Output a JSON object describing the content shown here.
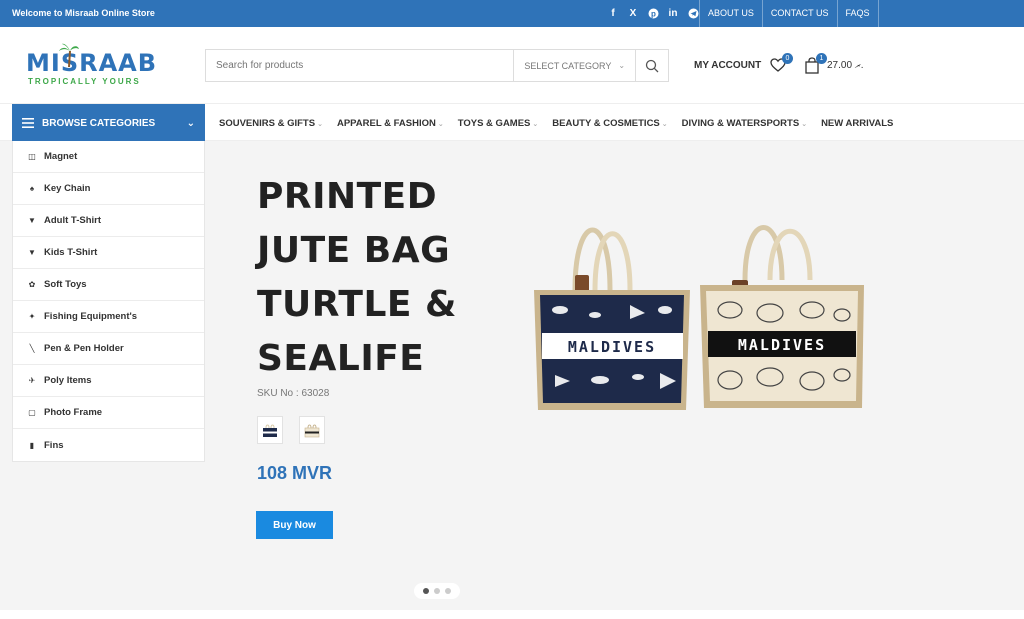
{
  "topbar": {
    "welcome": "Welcome to Misraab Online Store",
    "socials": [
      {
        "icon": "facebook-icon",
        "glyph": "f"
      },
      {
        "icon": "x-icon",
        "glyph": "X"
      },
      {
        "icon": "pinterest-icon",
        "glyph": "P"
      },
      {
        "icon": "linkedin-icon",
        "glyph": "in"
      },
      {
        "icon": "telegram-icon",
        "glyph": "➤"
      }
    ],
    "links": [
      "ABOUT US",
      "CONTACT US",
      "FAQS"
    ]
  },
  "logo": {
    "word": "MISRAAB",
    "tagline": "TROPICALLY YOURS"
  },
  "search": {
    "placeholder": "Search for products",
    "category": "SELECT CATEGORY"
  },
  "header": {
    "account": "MY ACCOUNT",
    "wishlist_count": "0",
    "cart_count": "1",
    "cart_total": "27.00 ރ."
  },
  "browse": {
    "label": "BROWSE CATEGORIES"
  },
  "nav": [
    {
      "label": "SOUVENIRS & GIFTS",
      "dropdown": true
    },
    {
      "label": "APPAREL & FASHION",
      "dropdown": true
    },
    {
      "label": "TOYS & GAMES",
      "dropdown": true
    },
    {
      "label": "BEAUTY & COSMETICS",
      "dropdown": true
    },
    {
      "label": "DIVING & WATERSPORTS",
      "dropdown": true
    },
    {
      "label": "NEW ARRIVALS",
      "dropdown": false
    }
  ],
  "categories": [
    {
      "label": "Magnet",
      "icon": "magnet-icon",
      "glyph": "◫"
    },
    {
      "label": "Key Chain",
      "icon": "keychain-icon",
      "glyph": "♠"
    },
    {
      "label": "Adult T-Shirt",
      "icon": "tshirt-icon",
      "glyph": "▼"
    },
    {
      "label": "Kids T-Shirt",
      "icon": "tshirt-icon",
      "glyph": "▼"
    },
    {
      "label": "Soft Toys",
      "icon": "soft-toy-icon",
      "glyph": "✿"
    },
    {
      "label": "Fishing Equipment's",
      "icon": "fishing-icon",
      "glyph": "✦"
    },
    {
      "label": "Pen & Pen Holder",
      "icon": "pen-icon",
      "glyph": "╲"
    },
    {
      "label": "Poly Items",
      "icon": "poly-icon",
      "glyph": "✈"
    },
    {
      "label": "Photo Frame",
      "icon": "photo-frame-icon",
      "glyph": "▢"
    },
    {
      "label": "Fins",
      "icon": "fins-icon",
      "glyph": "▮"
    }
  ],
  "hero": {
    "title_lines": [
      "PRINTED",
      "JUTE BAG",
      "TURTLE &",
      "SEALIFE"
    ],
    "sku": "SKU No : 63028",
    "price": "108 MVR",
    "button": "Buy Now",
    "bag_text": "MALDIVES",
    "active_slide": 1,
    "slides": 3
  },
  "colors": {
    "brand": "#2f73b8",
    "button": "#1a8ae0",
    "green": "#3ea84a"
  }
}
